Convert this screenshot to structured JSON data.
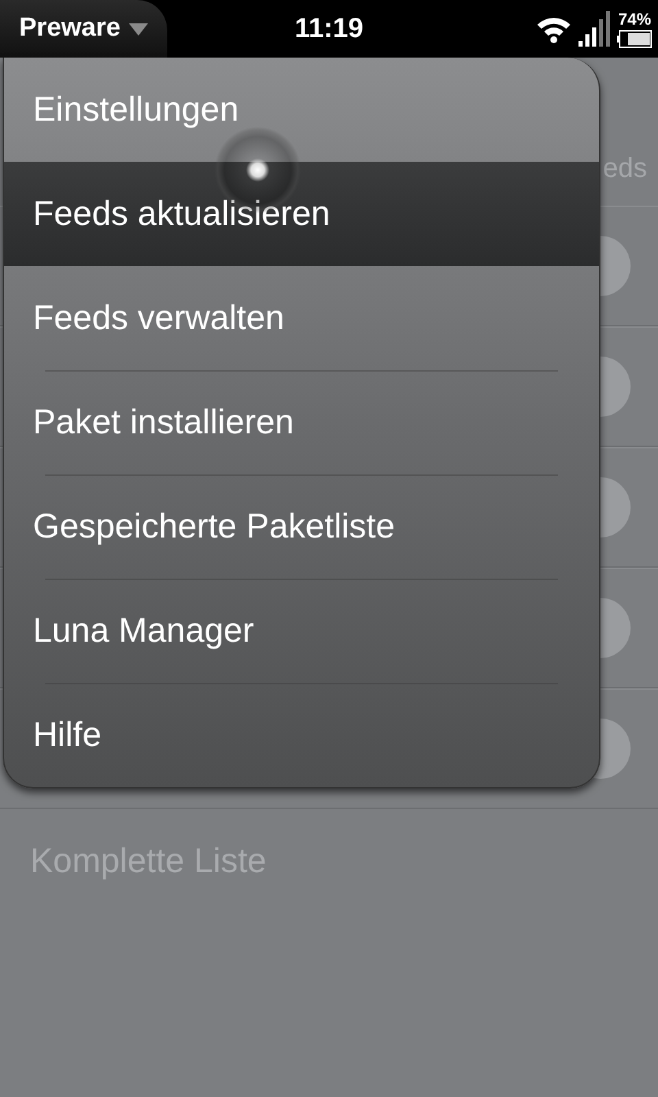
{
  "status_bar": {
    "app_menu": "Preware",
    "time": "11:19",
    "battery": "74%"
  },
  "background": {
    "header_text": "eds",
    "rows": [
      {
        "kind": "badge"
      },
      {
        "kind": "badge"
      },
      {
        "kind": "badge"
      },
      {
        "kind": "badge"
      },
      {
        "kind": "badge"
      }
    ],
    "last_item": "Komplette Liste"
  },
  "menu": {
    "items": [
      {
        "label": "Einstellungen",
        "selected": false
      },
      {
        "label": "Feeds aktualisieren",
        "selected": true
      },
      {
        "label": "Feeds verwalten",
        "selected": false
      },
      {
        "label": "Paket installieren",
        "selected": false
      },
      {
        "label": "Gespeicherte Paketliste",
        "selected": false
      },
      {
        "label": "Luna Manager",
        "selected": false
      },
      {
        "label": "Hilfe",
        "selected": false
      }
    ]
  }
}
